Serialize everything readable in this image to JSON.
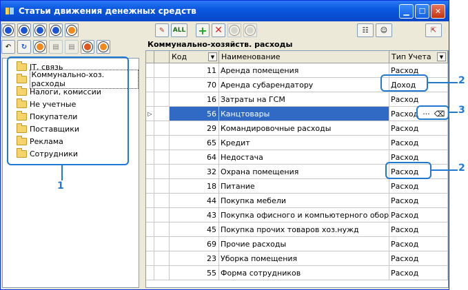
{
  "window": {
    "title": "Статьи движения денежных средств"
  },
  "tree": {
    "items": [
      {
        "label": "IT, связь"
      },
      {
        "label": "Коммунально-хоз. расходы"
      },
      {
        "label": "Налоги, комиссии"
      },
      {
        "label": "Не учетные"
      },
      {
        "label": "Покупатели"
      },
      {
        "label": "Поставщики"
      },
      {
        "label": "Реклама"
      },
      {
        "label": "Сотрудники"
      }
    ]
  },
  "main": {
    "section_title": "Коммунально-хозяйств. расходы",
    "toolbar": {
      "all_label": "ALL"
    },
    "columns": [
      "Код",
      "Наименование",
      "Тип Учета"
    ],
    "rows": [
      {
        "code": "11",
        "name": "Аренда помещения",
        "type": "Расход"
      },
      {
        "code": "70",
        "name": "Аренда субарендатору",
        "type": "Доход"
      },
      {
        "code": "16",
        "name": "Затраты на ГСМ",
        "type": "Расход"
      },
      {
        "code": "56",
        "name": "Канцтовары",
        "type": "Расход"
      },
      {
        "code": "29",
        "name": "Командировочные расходы",
        "type": "Расход"
      },
      {
        "code": "65",
        "name": "Кредит",
        "type": "Расход"
      },
      {
        "code": "64",
        "name": "Недостача",
        "type": "Расход"
      },
      {
        "code": "32",
        "name": "Охрана помещения",
        "type": "Расход"
      },
      {
        "code": "18",
        "name": "Питание",
        "type": "Расход"
      },
      {
        "code": "44",
        "name": "Покупка мебели",
        "type": "Расход"
      },
      {
        "code": "43",
        "name": "Покупка офисного и компьютерного оборудова",
        "type": "Расход"
      },
      {
        "code": "45",
        "name": "Покупка прочих товаров хоз.нужд",
        "type": "Расход"
      },
      {
        "code": "69",
        "name": "Прочие расходы",
        "type": "Расход"
      },
      {
        "code": "23",
        "name": "Уборка помещения",
        "type": "Расход"
      },
      {
        "code": "55",
        "name": "Форма сотрудников",
        "type": "Расход"
      }
    ],
    "selected_row": 3,
    "editor_buttons": {
      "ellipsis": "···",
      "eraser": "⌫"
    }
  },
  "callouts": {
    "one": "1",
    "two": "2",
    "three": "3"
  },
  "colors": {
    "accent": "#1f78d1",
    "selection": "#316ac5",
    "titlebar": "#0a58e0"
  }
}
